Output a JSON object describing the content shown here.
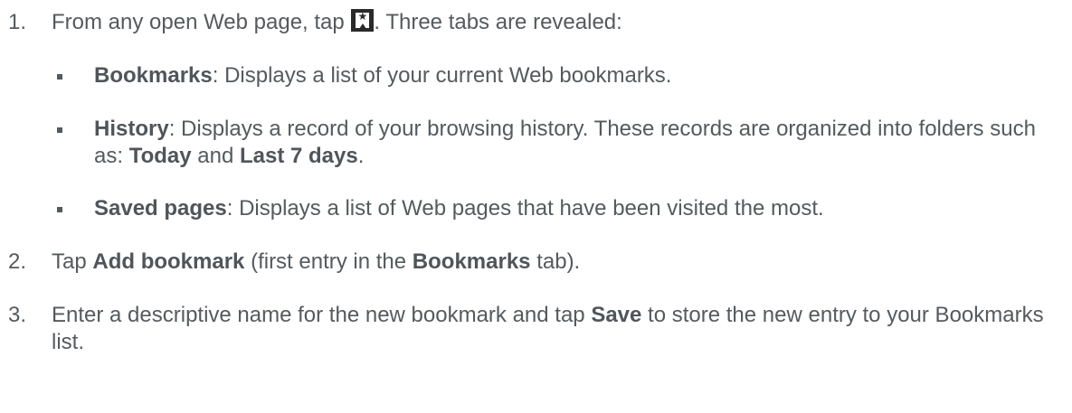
{
  "steps": [
    {
      "number": "1.",
      "text_before_icon": "From any open Web page, tap ",
      "icon": "bookmark-star-icon",
      "text_after_icon": ". Three tabs are revealed:",
      "bullets": [
        {
          "term": "Bookmarks",
          "description": ": Displays a list of your current Web bookmarks."
        },
        {
          "term": "History",
          "description": ": Displays a record of your browsing history. These records are organized into folders such as: ",
          "folder_1": "Today",
          "joiner": " and ",
          "folder_2": "Last 7 days",
          "end": "."
        },
        {
          "term": "Saved pages",
          "description": ": Displays a list of Web pages that have been visited the most."
        }
      ]
    },
    {
      "number": "2.",
      "text_1": "Tap ",
      "bold_1": "Add bookmark",
      "text_2": " (first entry in the ",
      "bold_2": "Bookmarks",
      "text_3": " tab)."
    },
    {
      "number": "3.",
      "text_1": "Enter a descriptive name for the new bookmark and tap ",
      "bold_1": "Save",
      "text_2": " to store the new entry to your Bookmarks list."
    }
  ],
  "colors": {
    "text": "#555a5e",
    "icon_bg": "#2a2a2a"
  }
}
